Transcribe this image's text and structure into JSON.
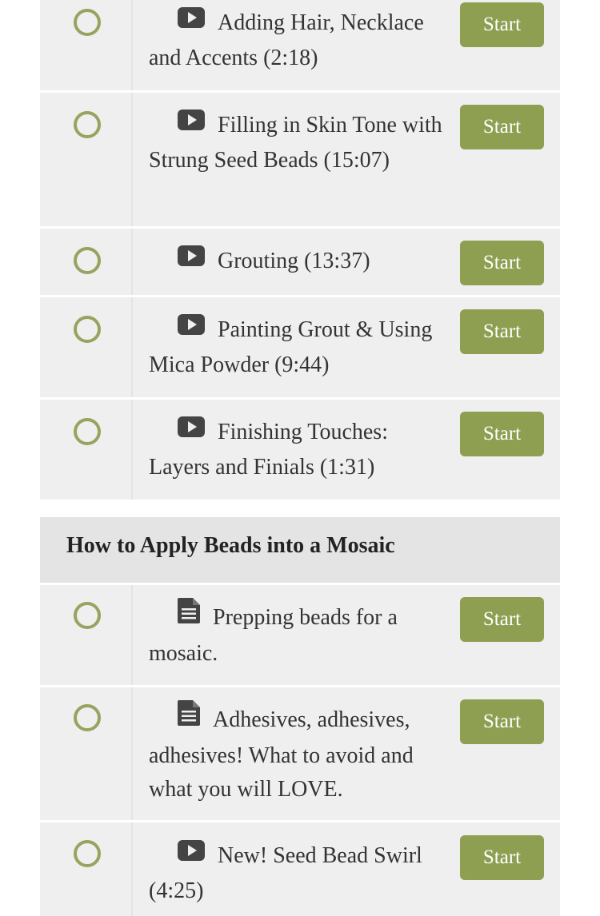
{
  "colors": {
    "row_bg": "#efefef",
    "section_bg": "#e4e4e4",
    "accent_green": "#8e9f51",
    "circle_green": "#97a35f",
    "text": "#333333"
  },
  "lessons": [
    {
      "icon": "video-play-icon",
      "title": "Adding Hair, Necklace and Accents (2:18)",
      "button": "Start"
    },
    {
      "icon": "video-play-icon",
      "title": "Filling in Skin Tone with Strung Seed Beads (15:07)",
      "button": "Start"
    },
    {
      "icon": "video-play-icon",
      "title": "Grouting (13:37)",
      "button": "Start"
    },
    {
      "icon": "video-play-icon",
      "title": "Painting Grout & Using Mica Powder (9:44)",
      "button": "Start"
    },
    {
      "icon": "video-play-icon",
      "title": "Finishing Touches: Layers and Finials (1:31)",
      "button": "Start"
    }
  ],
  "section": {
    "title": "How to Apply Beads into a Mosaic",
    "lessons": [
      {
        "icon": "document-icon",
        "title": "Prepping beads for a mosaic.",
        "button": "Start"
      },
      {
        "icon": "document-icon",
        "title": "Adhesives, adhesives, adhesives! What to avoid and what you will LOVE.",
        "button": "Start"
      },
      {
        "icon": "video-play-icon",
        "title": "New! Seed Bead Swirl (4:25)",
        "button": "Start"
      }
    ]
  }
}
